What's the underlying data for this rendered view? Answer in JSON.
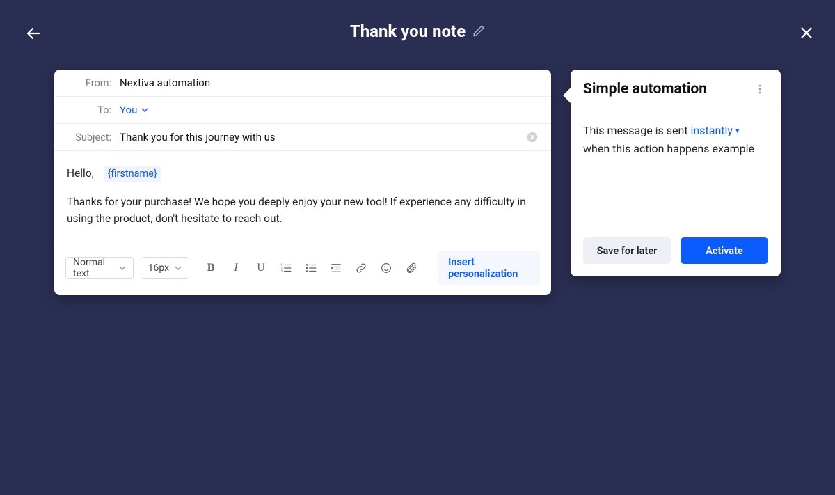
{
  "header": {
    "title": "Thank you note"
  },
  "composer": {
    "from_label": "From:",
    "from_value": "Nextiva automation",
    "to_label": "To:",
    "to_value": "You",
    "subject_label": "Subject:",
    "subject_value": "Thank you for this journey with us",
    "body": {
      "greeting": "Hello,",
      "chip": "{firstname}",
      "paragraph": "Thanks for your purchase! We hope you deeply enjoy your new tool! If experience any difficulty in using the product, don't hesitate to reach out."
    },
    "toolbar": {
      "style_select": "Normal text",
      "size_select": "16px",
      "insert_label": "Insert personalization"
    }
  },
  "side": {
    "title": "Simple automation",
    "sentence_a": "This message is sent",
    "timing": "instantly",
    "sentence_b": "when this action happens example",
    "save_label": "Save for later",
    "activate_label": "Activate"
  }
}
